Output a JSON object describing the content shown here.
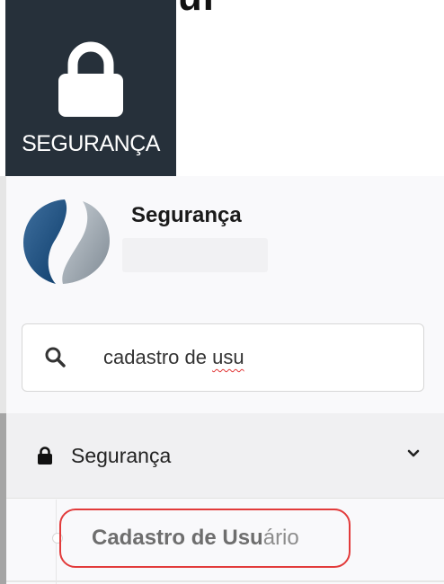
{
  "top_fragment": "gur",
  "module_tile": {
    "label": "SEGURANÇA",
    "icon": "lock-icon"
  },
  "brand": {
    "title": "Segurança",
    "logo_icon": "brand-logo"
  },
  "search": {
    "value_plain": "cadastro de ",
    "value_misspelled": "usu",
    "icon": "search-icon"
  },
  "menu": {
    "group_label": "Segurança",
    "group_icon": "lock-icon",
    "chevron_icon": "chevron-down-icon",
    "items": [
      {
        "label_match": "Cadastro de Usu",
        "label_rest": "ário"
      }
    ]
  },
  "colors": {
    "tile_bg": "#26303a",
    "highlight": "#e23b3b"
  }
}
